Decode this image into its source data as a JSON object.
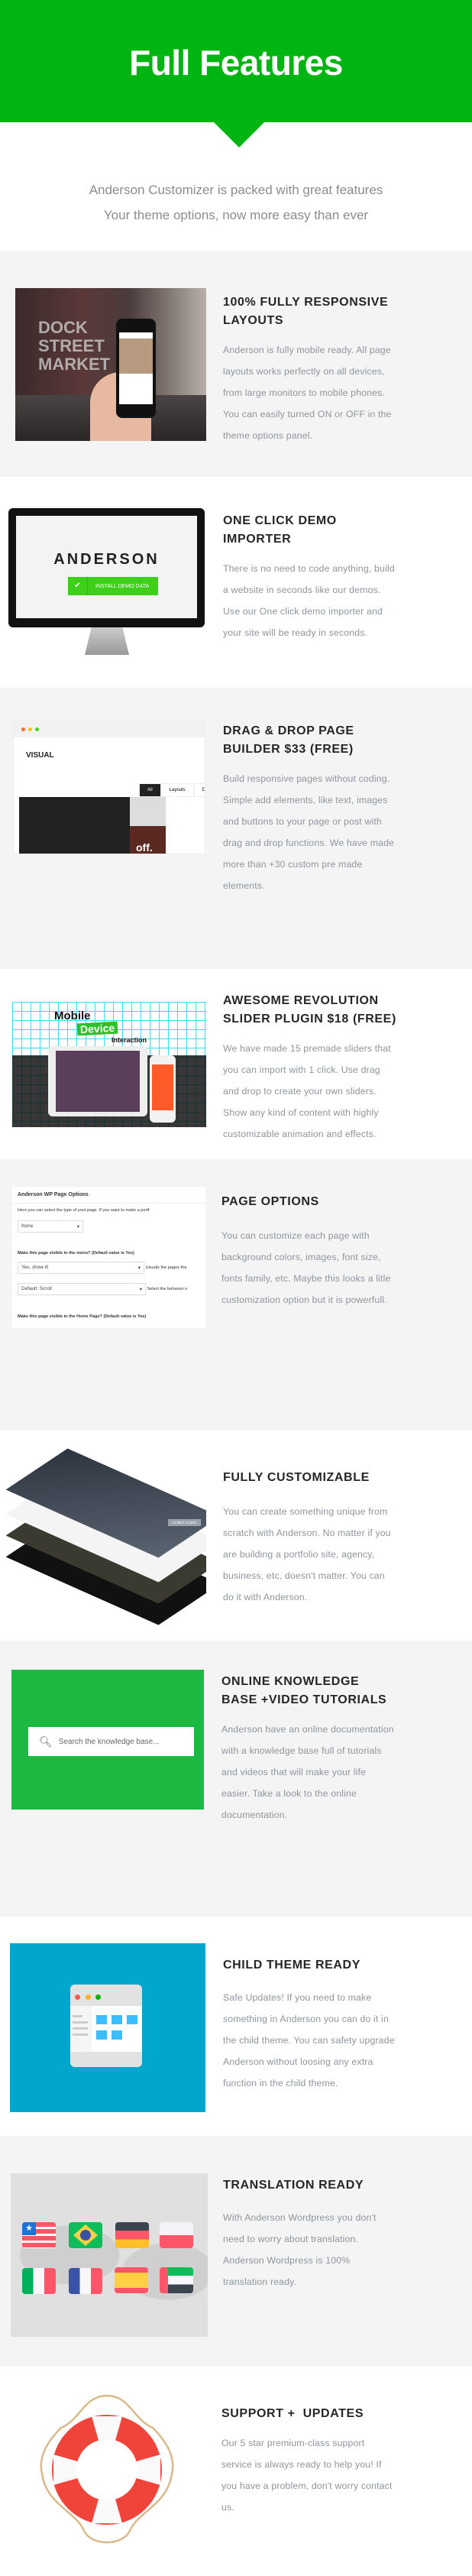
{
  "header": {
    "title": "Full Features",
    "accent": "#00b512",
    "intro_line1": "Anderson Customizer is packed with great features",
    "intro_line2": "Your theme options, now more easy than ever"
  },
  "features": [
    {
      "title": "100% Fully Responsive Layouts",
      "body": "Anderson is fully mobile ready. All page layouts works perfectly on all devices, from large monitors to mobile phones. You can easily turned ON or OFF in the theme options panel."
    },
    {
      "title": "One Click Demo Importer",
      "body": "There is no need to code anything, build a website in seconds like our demos. Use our One click demo importer and your site will be ready in seconds.",
      "screen_logo": "ANDERSON",
      "button_label": "INSTALL DEMO DATA"
    },
    {
      "title": "Drag & Drop Page Builder $33 (Free)",
      "body": "Build responsive pages without coding. Simple add elements, like text, images and buttons to your page or post with drag and drop functions. We have made more than +30 custom pre made elements.",
      "panel_title": "VISUAL",
      "tabs": [
        "All",
        "Layouts",
        "De"
      ],
      "image_text": "off."
    },
    {
      "title": "Awesome Revolution Slider Plugin $18 (Free)",
      "body": "We have made 15 premade sliders that you can import with 1 click. Use drag and drop to create your own sliders. Show any kind of content with highly customizable animation and effects.",
      "slide_line1": "Mobile",
      "slide_line2": "Device",
      "slide_line3": "Interaction"
    },
    {
      "title": "Page Options",
      "body": "You can customize each page with background colors, images, font size, fonts family, etc. Maybe this looks a litle customization option but it is powerfull.",
      "panel_title": "Anderson WP Page Options",
      "help_text": "Here you can select the type of your page. If you want to make a portf",
      "select_type": "None",
      "menu_label": "Make this page visible in the menu? (Default value is Yes)",
      "select_menu": "Yes, show it!",
      "menu_hint": "Usually the pages tha",
      "select_scroll": "Default: Scroll",
      "scroll_hint": "Select the behavior o",
      "home_label": "Make this page visible in the Home Page? (Default value is Yes)"
    },
    {
      "title": "Fully Customizable",
      "body": "You can create something unique from scratch with Anderson. No matter if you are building a portfolio site, agency, business, etc, doesn't matter. You can do it with Anderson.",
      "badge": "CLIENT ICONS"
    },
    {
      "title": "Online Knowledge Base +Video Tutorials",
      "body": "Anderson have an online documentation with a knowledge base full of tutorials and videos that will make your life easier. Take a look to the online documentation.",
      "search_placeholder": "Search the knowledge base..."
    },
    {
      "title": "Child Theme Ready",
      "body": "Safe Updates! If you need to make something in Anderson you can do it in the child theme. You can safety upgrade Anderson without loosing any extra function in the child theme."
    },
    {
      "title": "Translation Ready",
      "body": "With Anderson Wordpress you don't need to worry about translation. Anderson Wordpress is 100% translation ready.",
      "flags": [
        "usa-flag",
        "brazil-flag",
        "germany-flag",
        "poland-flag",
        "italy-flag",
        "france-flag",
        "spain-flag",
        "uae-flag"
      ]
    },
    {
      "title": "Support +  Updates",
      "body": "Our 5 star premium-class support service is always ready to help you! If you have a problem, don't worry contact us."
    }
  ]
}
